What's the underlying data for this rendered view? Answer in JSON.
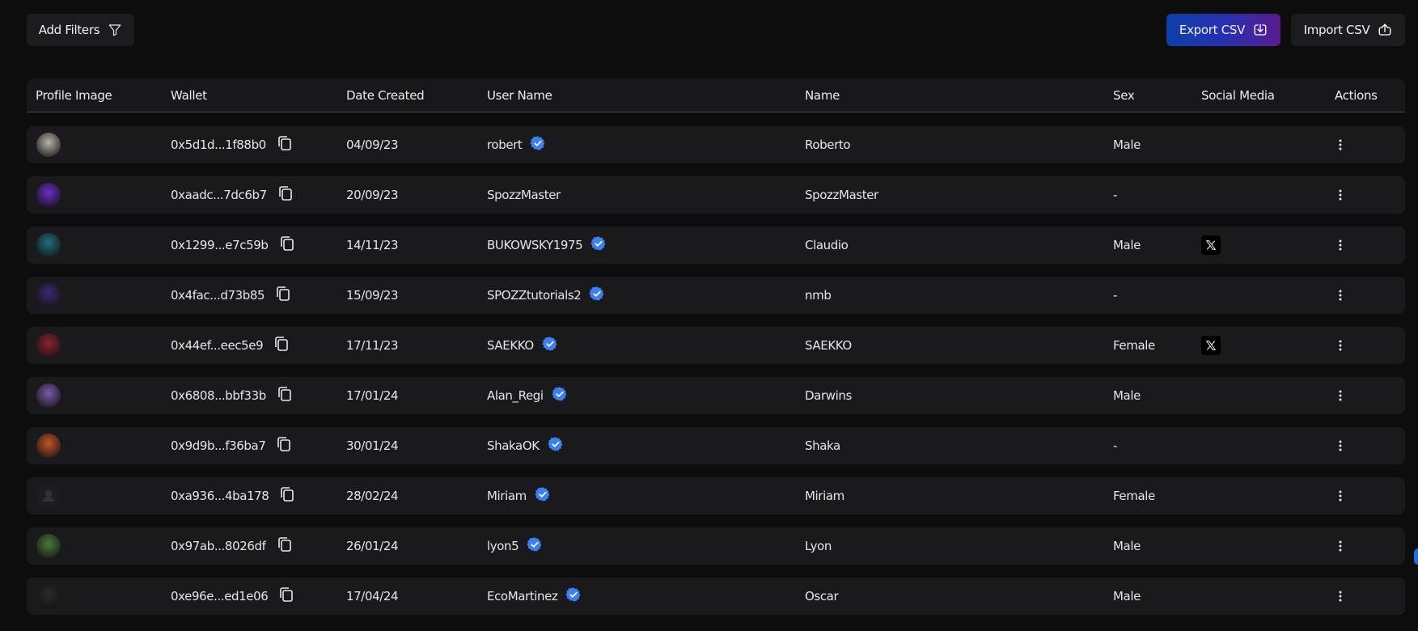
{
  "toolbar": {
    "add_filters_label": "Add Filters",
    "export_label": "Export CSV",
    "import_label": "Import CSV"
  },
  "columns": {
    "profile_image": "Profile Image",
    "wallet": "Wallet",
    "date_created": "Date Created",
    "user_name": "User Name",
    "name": "Name",
    "sex": "Sex",
    "social_media": "Social Media",
    "actions": "Actions"
  },
  "colors": {
    "verified_badge": "#3b7ff0",
    "export_gradient_start": "#0e3fa8",
    "export_gradient_end": "#5a1a8f"
  },
  "rows": [
    {
      "wallet": "0x5d1d...1f88b0",
      "date": "04/09/23",
      "username": "robert",
      "verified": true,
      "name": "Roberto",
      "sex": "Male",
      "social": "",
      "avatar": "#b9b3aa"
    },
    {
      "wallet": "0xaadc...7dc6b7",
      "date": "20/09/23",
      "username": "SpozzMaster",
      "verified": false,
      "name": "SpozzMaster",
      "sex": "-",
      "social": "",
      "avatar": "#6a2fc9"
    },
    {
      "wallet": "0x1299...e7c59b",
      "date": "14/11/23",
      "username": "BUKOWSKY1975",
      "verified": true,
      "name": "Claudio",
      "sex": "Male",
      "social": "x-icon",
      "avatar": "#1f6f7e"
    },
    {
      "wallet": "0x4fac...d73b85",
      "date": "15/09/23",
      "username": "SPOZZtutorials2",
      "verified": true,
      "name": "nmb",
      "sex": "-",
      "social": "",
      "avatar": "#3b2a6e"
    },
    {
      "wallet": "0x44ef...eec5e9",
      "date": "17/11/23",
      "username": "SAEKKO",
      "verified": true,
      "name": "SAEKKO",
      "sex": "Female",
      "social": "x-icon",
      "avatar": "#8a2230"
    },
    {
      "wallet": "0x6808...bbf33b",
      "date": "17/01/24",
      "username": "Alan_Regi",
      "verified": true,
      "name": "Darwins",
      "sex": "Male",
      "social": "",
      "avatar": "#7a5aa8"
    },
    {
      "wallet": "0x9d9b...f36ba7",
      "date": "30/01/24",
      "username": "ShakaOK",
      "verified": true,
      "name": "Shaka",
      "sex": "-",
      "social": "",
      "avatar": "#c2542a"
    },
    {
      "wallet": "0xa936...4ba178",
      "date": "28/02/24",
      "username": "Miriam",
      "verified": true,
      "name": "Miriam",
      "sex": "Female",
      "social": "",
      "avatar": "#1c1c1e"
    },
    {
      "wallet": "0x97ab...8026df",
      "date": "26/01/24",
      "username": "lyon5",
      "verified": true,
      "name": "Lyon",
      "sex": "Male",
      "social": "",
      "avatar": "#4b7a3a"
    },
    {
      "wallet": "0xe96e...ed1e06",
      "date": "17/04/24",
      "username": "EcoMartinez",
      "verified": true,
      "name": "Oscar",
      "sex": "Male",
      "social": "",
      "avatar": "#2a2a2a"
    }
  ]
}
